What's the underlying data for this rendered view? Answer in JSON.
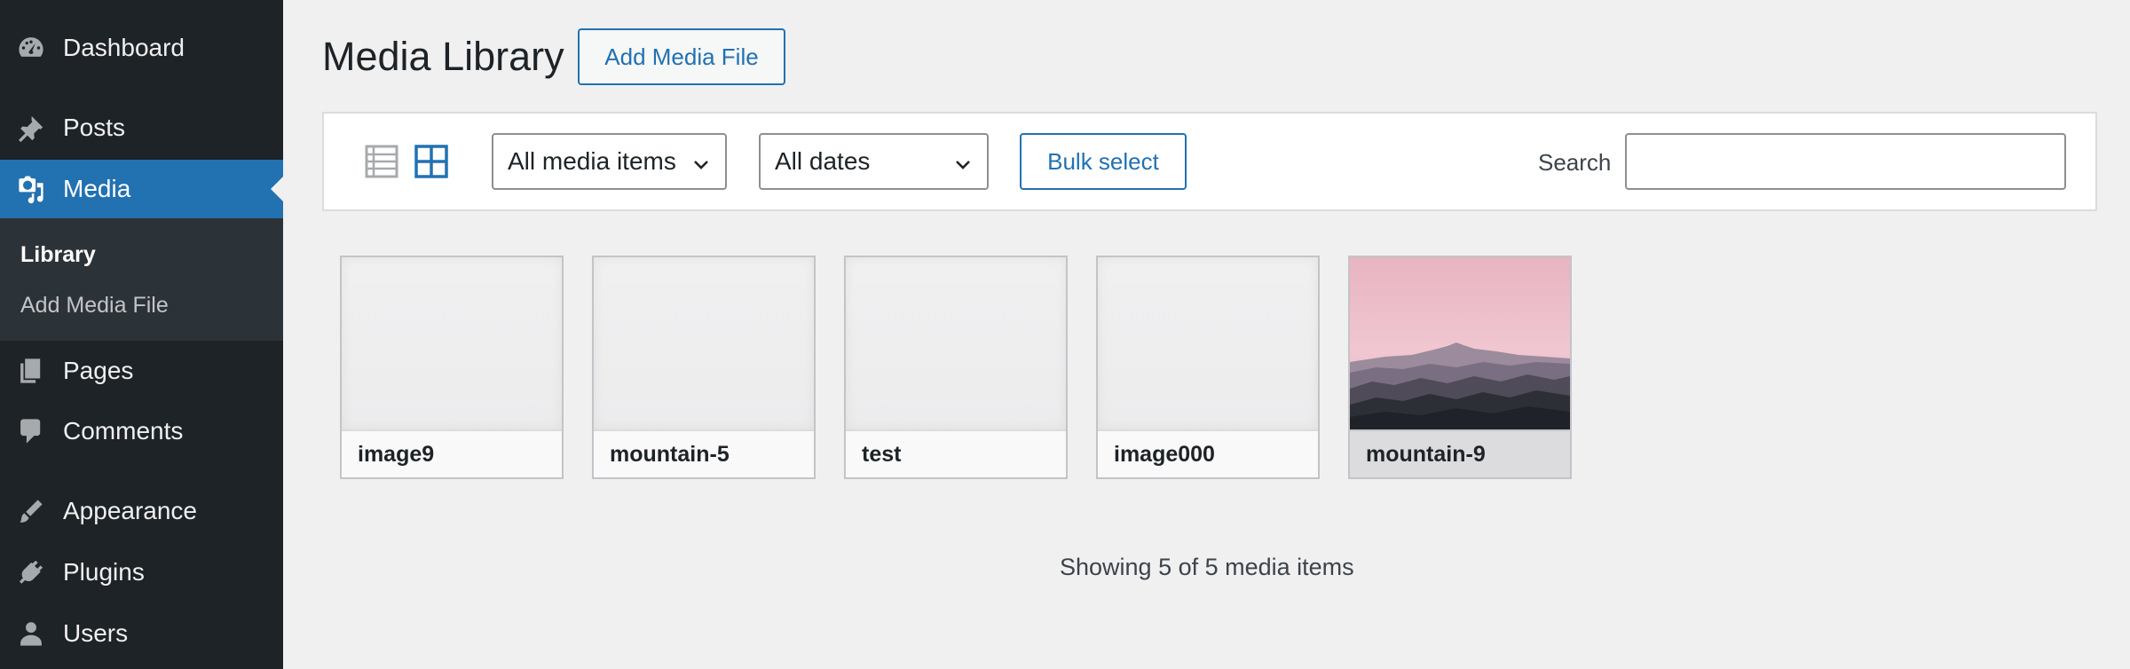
{
  "sidebar": {
    "items": [
      {
        "label": "Dashboard",
        "icon": "dashboard-icon"
      },
      {
        "label": "Posts",
        "icon": "pin-icon"
      },
      {
        "label": "Media",
        "icon": "media-icon"
      },
      {
        "label": "Pages",
        "icon": "pages-icon"
      },
      {
        "label": "Comments",
        "icon": "comment-icon"
      },
      {
        "label": "Appearance",
        "icon": "brush-icon"
      },
      {
        "label": "Plugins",
        "icon": "plugin-icon"
      },
      {
        "label": "Users",
        "icon": "user-icon"
      }
    ],
    "submenu": [
      {
        "label": "Library"
      },
      {
        "label": "Add Media File"
      }
    ]
  },
  "header": {
    "title": "Media Library",
    "add_button": "Add Media File"
  },
  "toolbar": {
    "view_modes": [
      "list-view-icon",
      "grid-view-icon"
    ],
    "type_filter": "All media items",
    "date_filter": "All dates",
    "bulk_select": "Bulk select",
    "search_label": "Search",
    "search_value": ""
  },
  "media": [
    {
      "name": "image9"
    },
    {
      "name": "mountain-5"
    },
    {
      "name": "test"
    },
    {
      "name": "image000"
    },
    {
      "name": "mountain-9"
    }
  ],
  "footer": {
    "count_text": "Showing 5 of 5 media items"
  },
  "colors": {
    "sidebar_bg": "#1d2327",
    "submenu_bg": "#2c3338",
    "accent": "#2271b1",
    "page_bg": "#f0f0f1"
  }
}
